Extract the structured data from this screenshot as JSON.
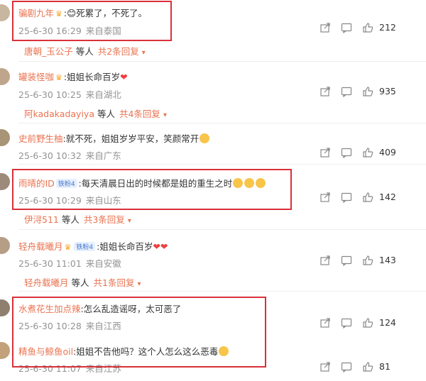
{
  "comments": [
    {
      "username": "骗剧九年",
      "text": ":😊死累了，不死了。",
      "date": "25-6-30 16:29",
      "location": "来自泰国",
      "likes": "212",
      "reply": {
        "name": "唐朝_玉公子",
        "connector": "等人",
        "count": "共2条回复"
      }
    },
    {
      "username": "罐装怪咖",
      "text": ":姐姐长命百岁",
      "date": "25-6-30 10:25",
      "location": "来自湖北",
      "likes": "935",
      "reply": {
        "name": "阿kadakadayiya",
        "connector": "等人",
        "count": "共4条回复"
      }
    },
    {
      "username": "史前野生柚",
      "text": ":就不死，姐姐岁岁平安，笑颜常开",
      "date": "25-6-30 10:32",
      "location": "来自广东",
      "likes": "409"
    },
    {
      "username": "雨晴的ID",
      "badge": "铁粉4",
      "text": ":每天清晨日出的时候都是姐的重生之时",
      "date": "25-6-30 10:29",
      "location": "来自山东",
      "likes": "142",
      "reply": {
        "name": "伊浔511",
        "connector": "等人",
        "count": "共3条回复"
      }
    },
    {
      "username": "轻舟载曦月",
      "badge": "铁粉4",
      "text": ":姐姐长命百岁",
      "date": "25-6-30 11:01",
      "location": "来自安徽",
      "likes": "143",
      "reply": {
        "name": "轻舟载曦月",
        "connector": "等人",
        "count": "共1条回复"
      }
    },
    {
      "username": "水煮花生加点辣",
      "text": ":怎么乱造谣呀，太可恶了",
      "date": "25-6-30 10:28",
      "location": "来自江西",
      "likes": "124"
    },
    {
      "username": "精鱼与鲸鱼oil",
      "text": ":姐姐不告他吗？这个人怎么这么恶毒",
      "date": "25-6-30 11:07",
      "location": "来自江苏",
      "likes": "81"
    }
  ],
  "colors": {
    "username": "#eb7350",
    "meta": "#939393",
    "highlight": "#d9313a",
    "heart": "#ef3f3f"
  },
  "icons": [
    "share-icon",
    "comment-icon",
    "like-icon",
    "crown-icon",
    "heart-icon",
    "emoji-icon"
  ]
}
